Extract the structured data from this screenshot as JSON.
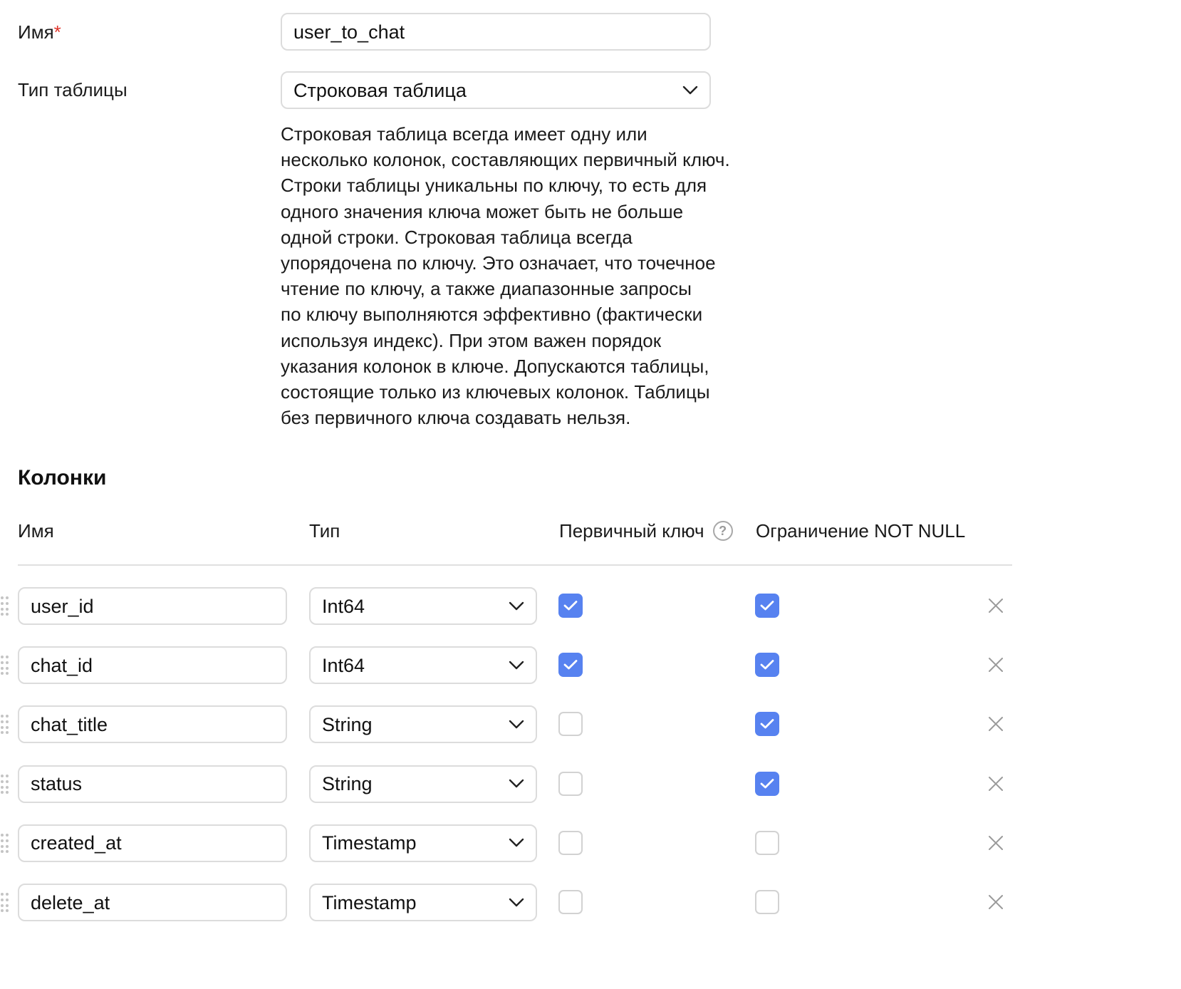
{
  "form": {
    "name_label": "Имя",
    "required_mark": "*",
    "name_value": "user_to_chat",
    "table_type_label": "Тип таблицы",
    "table_type_value": "Строковая таблица",
    "description_lines": [
      "Строковая таблица всегда имеет одну или",
      "несколько колонок, составляющих первичный ключ.",
      "Строки таблицы уникальны по ключу, то есть для",
      "одного значения ключа может быть не больше",
      "одной строки. Строковая таблица всегда",
      "упорядочена по ключу. Это означает, что точечное",
      "чтение по ключу, а также диапазонные запросы",
      "по ключу выполняются эффективно (фактически",
      "используя индекс). При этом важен порядок",
      "указания колонок в ключе. Допускаются таблицы,",
      "состоящие только из ключевых колонок. Таблицы",
      "без первичного ключа создавать нельзя."
    ]
  },
  "columns": {
    "title": "Колонки",
    "headers": {
      "name": "Имя",
      "type": "Тип",
      "primary_key": "Первичный ключ",
      "help": "?",
      "not_null": "Ограничение NOT NULL"
    },
    "rows": [
      {
        "name": "user_id",
        "type": "Int64",
        "primary_key": true,
        "not_null": true
      },
      {
        "name": "chat_id",
        "type": "Int64",
        "primary_key": true,
        "not_null": true
      },
      {
        "name": "chat_title",
        "type": "String",
        "primary_key": false,
        "not_null": true
      },
      {
        "name": "status",
        "type": "String",
        "primary_key": false,
        "not_null": true
      },
      {
        "name": "created_at",
        "type": "Timestamp",
        "primary_key": false,
        "not_null": false
      },
      {
        "name": "delete_at",
        "type": "Timestamp",
        "primary_key": false,
        "not_null": false
      }
    ]
  },
  "colors": {
    "accent": "#5782f0",
    "required": "#e0342a",
    "border": "#dcdcdc"
  }
}
